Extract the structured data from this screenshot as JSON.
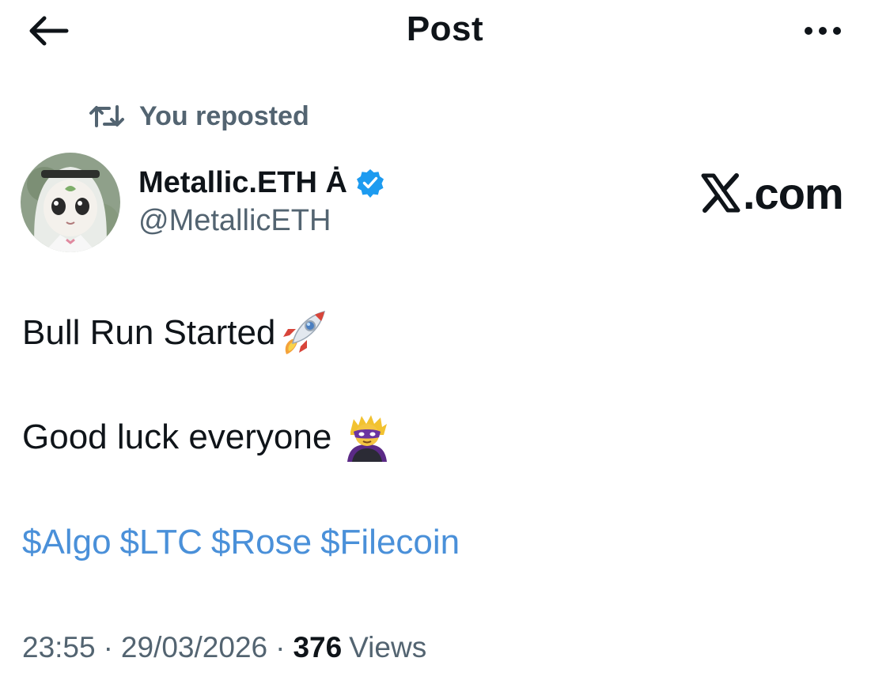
{
  "header": {
    "title": "Post",
    "back_icon": "arrow-left-icon",
    "more_icon": "more-horizontal-icon"
  },
  "repost": {
    "icon": "repost-icon",
    "label": "You reposted"
  },
  "author": {
    "display_name": "Metallic.ETH Ȧ",
    "handle": "@MetallicETH",
    "verified": true,
    "verified_color": "#1d9bf0"
  },
  "watermark": {
    "text": ".com"
  },
  "post": {
    "line1_text": "Bull Run Started",
    "line1_emoji": "rocket-emoji",
    "line2_text": "Good luck everyone",
    "line2_emoji": "supervillain-emoji",
    "cashtags": [
      "$Algo",
      "$LTC",
      "$Rose",
      "$Filecoin"
    ],
    "cashtag_color": "#4a90d9"
  },
  "meta": {
    "time": "23:55",
    "separator": "·",
    "date": "29/03/2026",
    "views_count": "376",
    "views_label": "Views"
  }
}
